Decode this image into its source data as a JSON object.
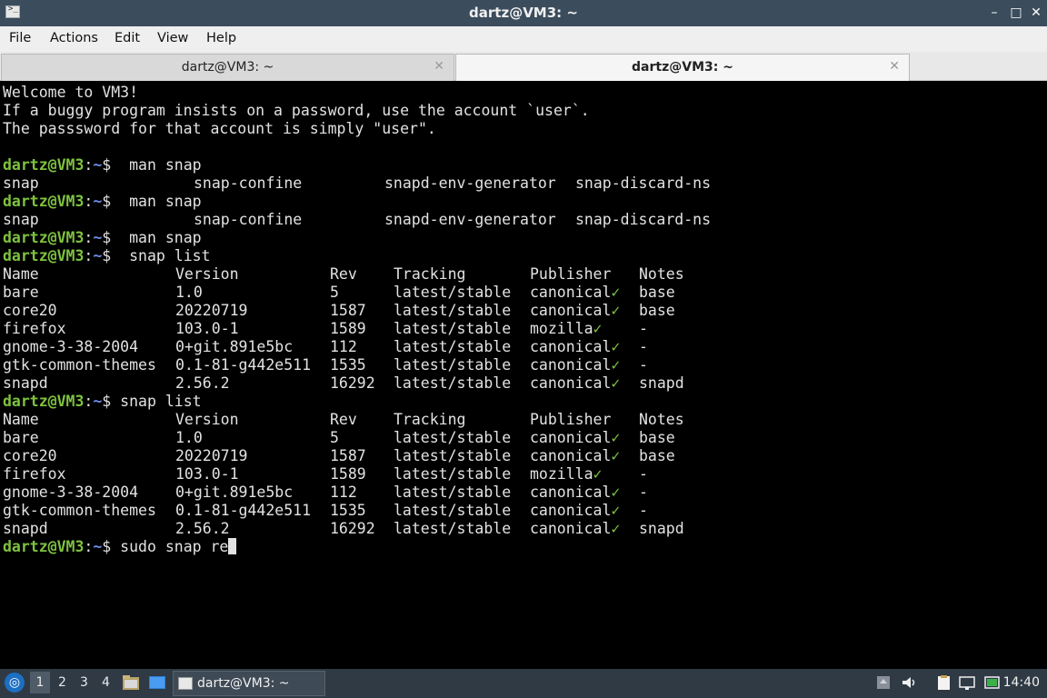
{
  "window": {
    "title": "dartz@VM3: ~"
  },
  "menu": [
    "File",
    "Actions",
    "Edit",
    "View",
    "Help"
  ],
  "tabs": [
    {
      "label": "dartz@VM3: ~",
      "active": false
    },
    {
      "label": "dartz@VM3: ~",
      "active": true
    }
  ],
  "terminal": {
    "welcome": [
      "Welcome to VM3!",
      "If a buggy program insists on a password, use the account `user`.",
      "The passsword for that account is simply \"user\"."
    ],
    "prompt": {
      "user": "dartz@VM3",
      "sep": ":",
      "path": "~",
      "sign": "$"
    },
    "commands": [
      "man snap",
      "man snap",
      "man snap",
      "snap list",
      "snap list",
      "sudo snap re"
    ],
    "completions": [
      "snap",
      "snap-confine",
      "snapd-env-generator",
      "snap-discard-ns"
    ],
    "snap_headers": [
      "Name",
      "Version",
      "Rev",
      "Tracking",
      "Publisher",
      "Notes"
    ],
    "snap_rows": [
      [
        "bare",
        "1.0",
        "5",
        "latest/stable",
        "canonical",
        "base"
      ],
      [
        "core20",
        "20220719",
        "1587",
        "latest/stable",
        "canonical",
        "base"
      ],
      [
        "firefox",
        "103.0-1",
        "1589",
        "latest/stable",
        "mozilla",
        "-"
      ],
      [
        "gnome-3-38-2004",
        "0+git.891e5bc",
        "112",
        "latest/stable",
        "canonical",
        "-"
      ],
      [
        "gtk-common-themes",
        "0.1-81-g442e511",
        "1535",
        "latest/stable",
        "canonical",
        "-"
      ],
      [
        "snapd",
        "2.56.2",
        "16292",
        "latest/stable",
        "canonical",
        "snapd"
      ]
    ],
    "check": "✓"
  },
  "taskbar": {
    "workspaces": [
      "1",
      "2",
      "3",
      "4"
    ],
    "task_label": "dartz@VM3: ~",
    "clock": "14:40",
    "icons": [
      "start-menu-icon",
      "file-manager-icon",
      "desktop-icon",
      "terminal-icon",
      "update-icon",
      "volume-icon",
      "clipboard-icon",
      "network-icon",
      "battery-icon"
    ]
  }
}
